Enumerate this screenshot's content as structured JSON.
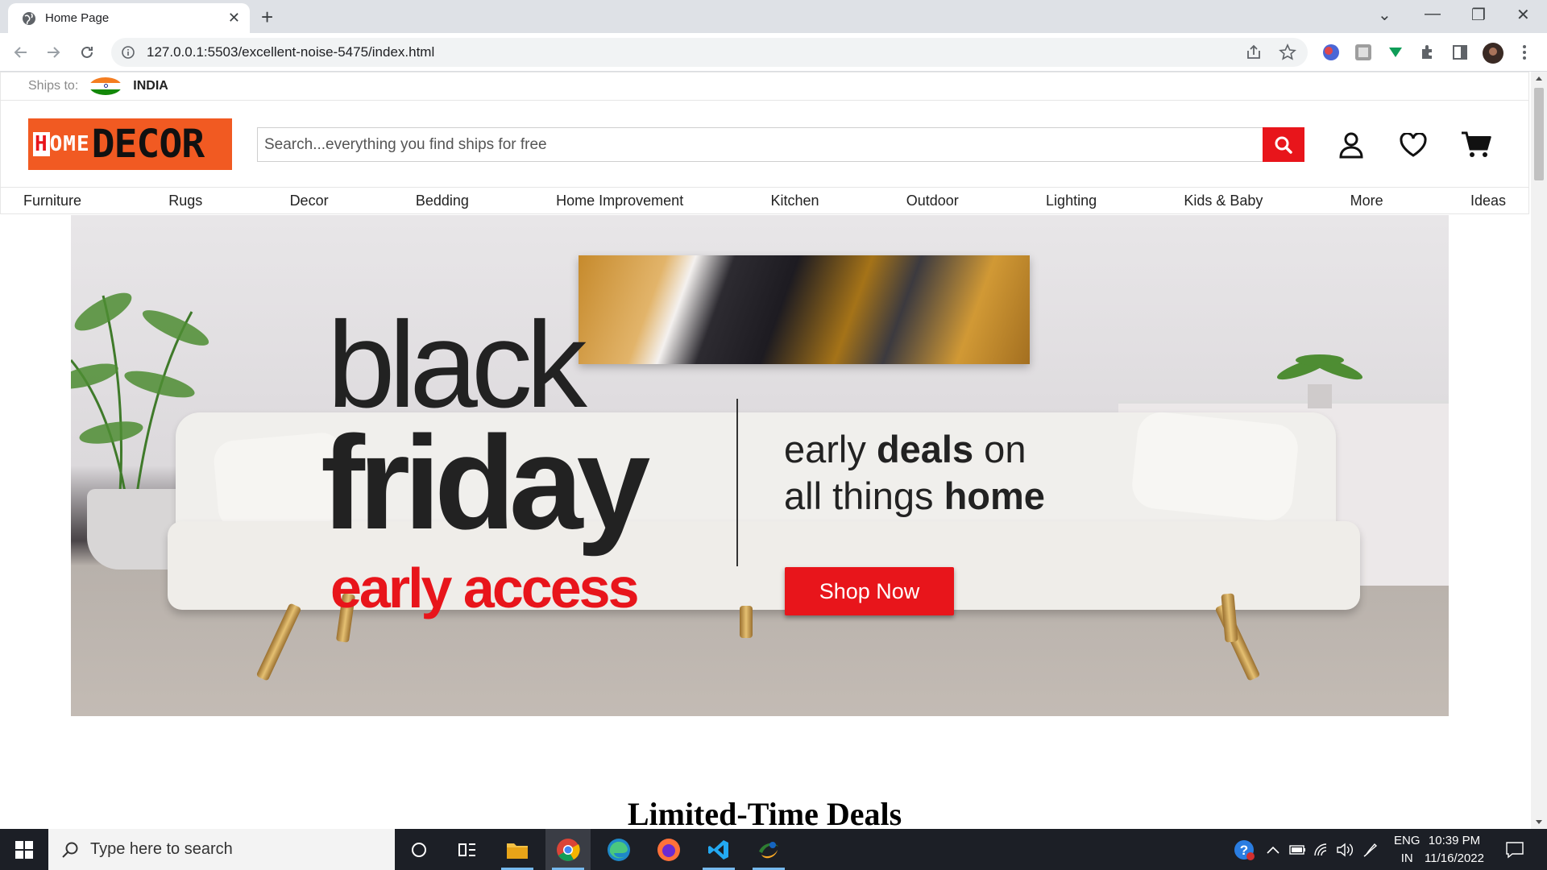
{
  "browser": {
    "tab_title": "Home Page",
    "url": "127.0.0.1:5503/excellent-noise-5475/index.html"
  },
  "site": {
    "ships_to_label": "Ships to:",
    "country": "INDIA",
    "logo_home": "OME",
    "logo_home_h": "H",
    "logo_decor": "DECOR",
    "search_placeholder": "Search...everything you find ships for free",
    "nav": [
      "Furniture",
      "Rugs",
      "Decor",
      "Bedding",
      "Home Improvement",
      "Kitchen",
      "Outdoor",
      "Lighting",
      "Kids & Baby",
      "More",
      "Ideas"
    ],
    "banner": {
      "line1": "black",
      "line2": "friday",
      "line3": "early access",
      "tag_pre1": "early ",
      "tag_bold1": "deals",
      "tag_post1": " on",
      "tag_pre2": "all things ",
      "tag_bold2": "home",
      "cta": "Shop Now"
    },
    "section_title": "Limited-Time Deals"
  },
  "colors": {
    "brand_red": "#e8151b",
    "logo_orange": "#f15a22"
  },
  "taskbar": {
    "search_placeholder": "Type here to search",
    "lang_top": "ENG",
    "lang_bottom": "IN",
    "time": "10:39 PM",
    "date": "11/16/2022"
  }
}
